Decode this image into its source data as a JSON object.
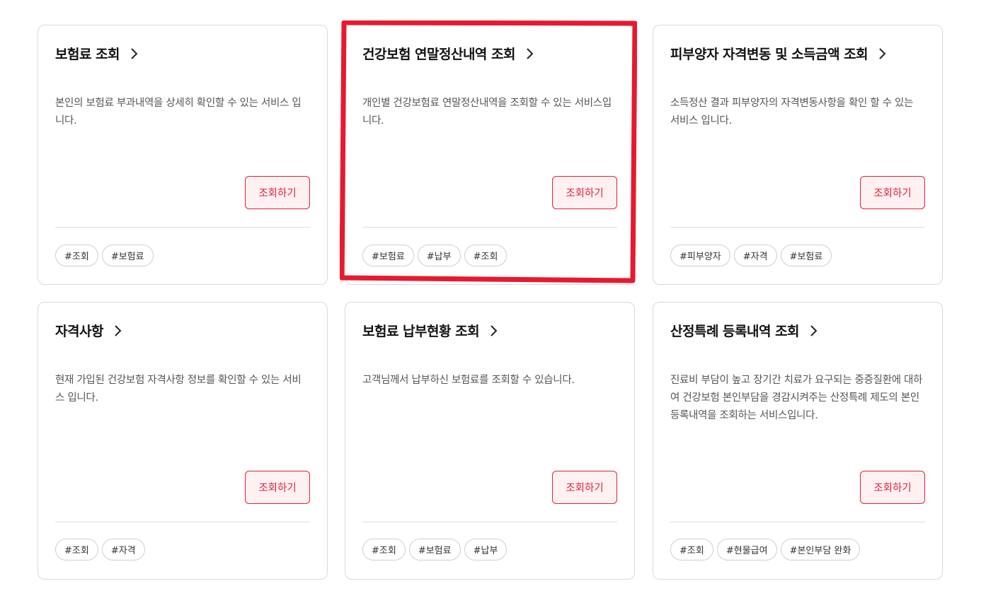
{
  "cards": [
    {
      "title": "보험료 조회",
      "description": "본인의 보험료 부과내역을 상세히 확인할 수 있는 서비스 입니다.",
      "button": "조회하기",
      "tags": [
        "#조회",
        "#보험료"
      ]
    },
    {
      "title": "건강보험 연말정산내역 조회",
      "description": "개인별 건강보험료 연말정산내역을 조회할 수 있는 서비스입니다.",
      "button": "조회하기",
      "tags": [
        "#보험료",
        "#납부",
        "#조회"
      ]
    },
    {
      "title": "피부양자 자격변동 및 소득금액 조회",
      "description": "소득정산 결과 피부양자의 자격변동사항을 확인 할 수 있는 서비스 입니다.",
      "button": "조회하기",
      "tags": [
        "#피부양자",
        "#자격",
        "#보험료"
      ]
    },
    {
      "title": "자격사항",
      "description": "현재 가입된 건강보험 자격사항 정보를 확인할 수 있는 서비스 입니다.",
      "button": "조회하기",
      "tags": [
        "#조회",
        "#자격"
      ]
    },
    {
      "title": "보험료 납부현황 조회",
      "description": "고객님께서 납부하신 보험료를 조회할 수 있습니다.",
      "button": "조회하기",
      "tags": [
        "#조회",
        "#보험료",
        "#납부"
      ]
    },
    {
      "title": "산정특례 등록내역 조회",
      "description": "진료비 부담이 높고 장기간 치료가 요구되는 중증질환에 대하여 건강보험 본인부담을 경감시켜주는 산정특례 제도의 본인 등록내역을 조회하는 서비스입니다.",
      "button": "조회하기",
      "tags": [
        "#조회",
        "#현물급여",
        "#본인부담 완화"
      ]
    }
  ],
  "colors": {
    "accent": "#e0223a",
    "button_bg": "#fff1f2",
    "highlight": "#e8192f"
  },
  "icons": {
    "title_arrow": "chevron-right-icon"
  }
}
